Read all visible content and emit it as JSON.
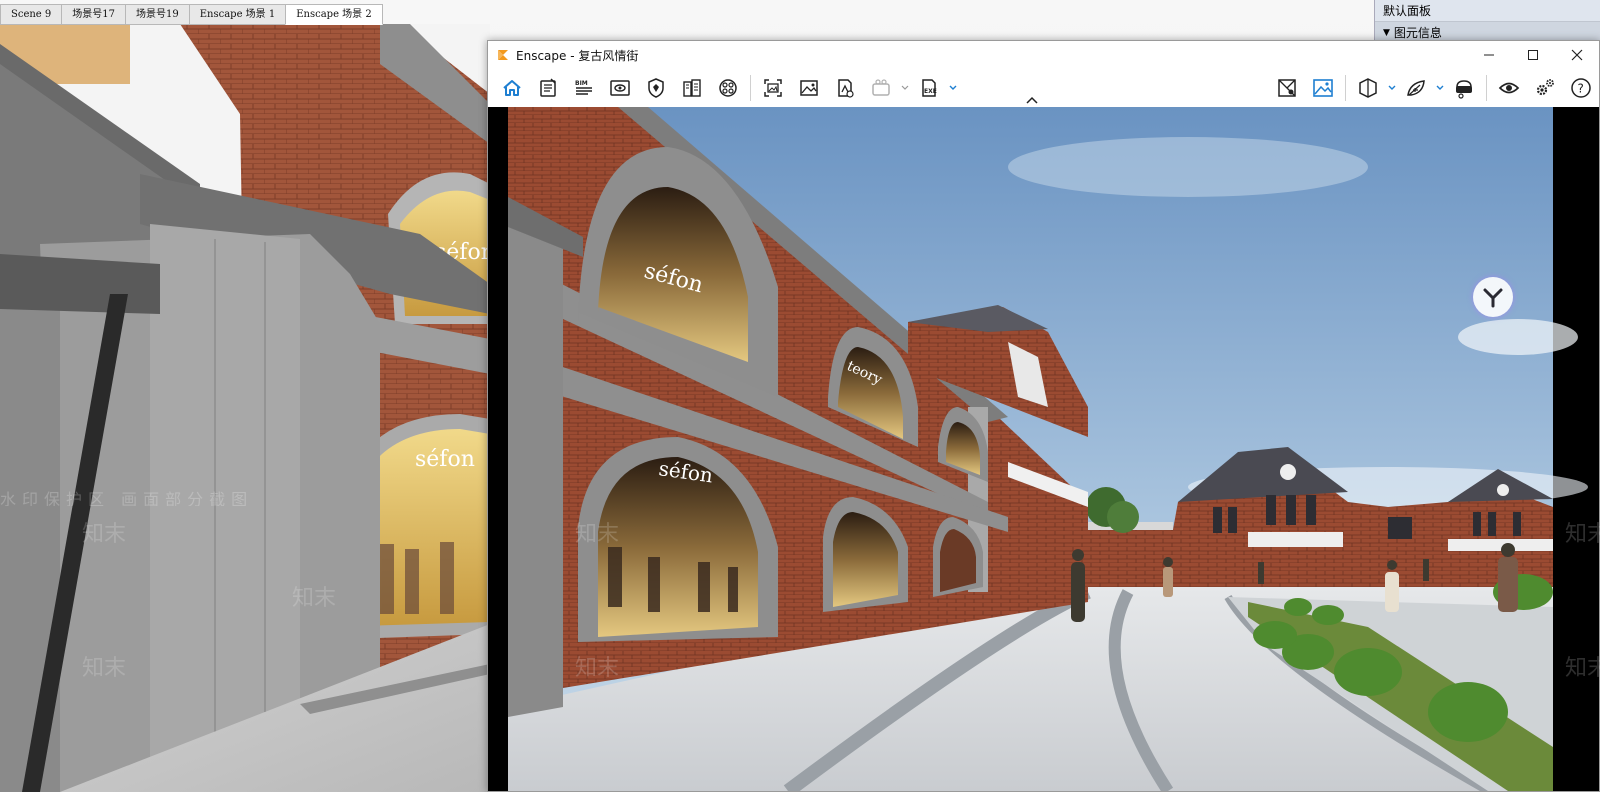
{
  "sketchup": {
    "tabs": [
      "Scene 9",
      "场景号17",
      "场景号19",
      "Enscape 场景 1",
      "Enscape 场景 2"
    ],
    "active_tab_index": 4,
    "shop_signs": [
      "séfon",
      "séfon"
    ]
  },
  "tray": {
    "title": "默认面板",
    "section": "图元信息"
  },
  "enscape": {
    "window_title": "Enscape - 复古风情街",
    "toolbar_left": [
      {
        "name": "home",
        "icon": "home-icon",
        "active": true
      },
      {
        "name": "notes",
        "icon": "notes-icon"
      },
      {
        "name": "bim",
        "icon": "bim-icon"
      },
      {
        "name": "views",
        "icon": "views-icon"
      },
      {
        "name": "safe-mode",
        "icon": "shield-icon"
      },
      {
        "name": "asset-library",
        "icon": "asset-library-icon"
      },
      {
        "name": "material-editor",
        "icon": "material-editor-icon"
      },
      {
        "name": "screenshot",
        "icon": "screenshot-icon"
      },
      {
        "name": "batch-render",
        "icon": "batch-render-icon"
      },
      {
        "name": "export-panorama",
        "icon": "panorama-icon"
      },
      {
        "name": "video",
        "icon": "video-icon",
        "disabled": true
      },
      {
        "name": "export-exe",
        "icon": "exe-export-icon"
      }
    ],
    "toolbar_right": [
      {
        "name": "map",
        "icon": "map-icon"
      },
      {
        "name": "visual-settings",
        "icon": "visual-settings-icon",
        "active": true
      },
      {
        "name": "sections",
        "icon": "sections-icon"
      },
      {
        "name": "atmosphere",
        "icon": "atmosphere-icon"
      },
      {
        "name": "vr-headset",
        "icon": "vr-headset-icon"
      },
      {
        "name": "visibility",
        "icon": "eye-icon"
      },
      {
        "name": "settings",
        "icon": "gear-icon"
      },
      {
        "name": "help",
        "icon": "help-icon"
      }
    ],
    "shop_signs": [
      "séfon",
      "séfon",
      "teory"
    ]
  },
  "watermark": {
    "brand": "知末",
    "band": "水印保护区 画面部分截图"
  },
  "colors": {
    "brick": "#9b4b32",
    "stone": "#9a9a9a",
    "sky_top": "#6a93c2",
    "sky_bottom": "#c9dbe9",
    "enscape_accent": "#1e7fd1",
    "enscape_logo": "#f39a1e"
  }
}
